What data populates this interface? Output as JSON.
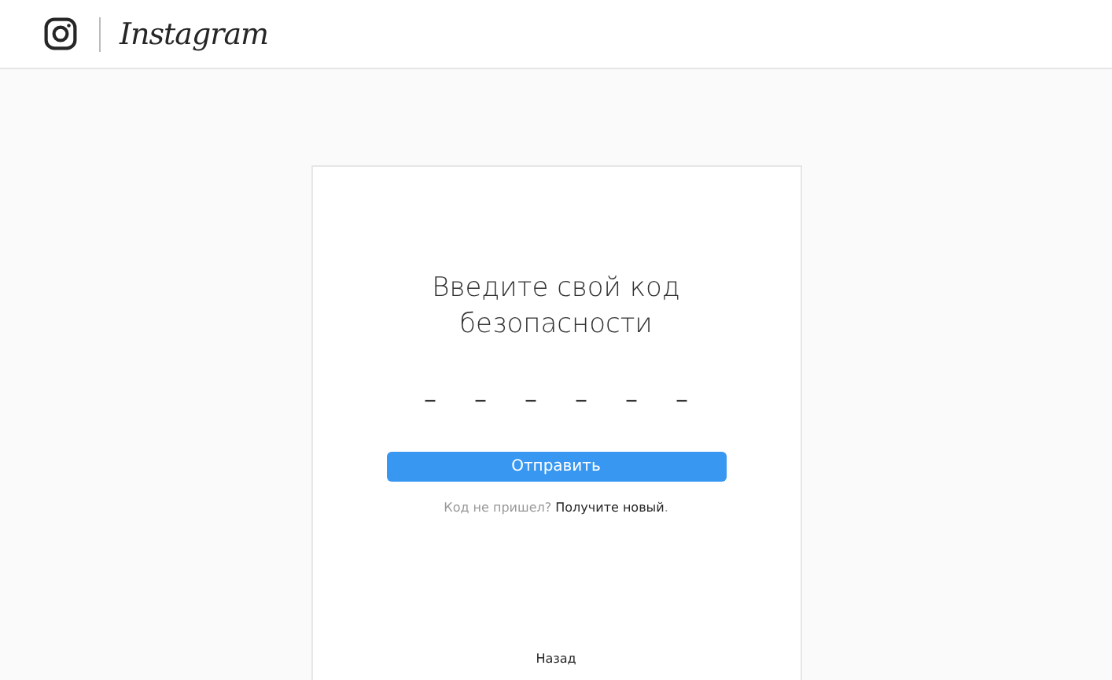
{
  "header": {
    "logo": "Instagram"
  },
  "card": {
    "title": "Введите свой код безопасности",
    "code_fields": [
      {
        "placeholder": "–"
      },
      {
        "placeholder": "–"
      },
      {
        "placeholder": "–"
      },
      {
        "placeholder": "–"
      },
      {
        "placeholder": "–"
      },
      {
        "placeholder": "–"
      }
    ],
    "submit_button": "Отправить",
    "resend_prompt": "Код не пришел?",
    "resend_link": "Получите новый",
    "resend_end": ".",
    "back_link": "Назад"
  }
}
